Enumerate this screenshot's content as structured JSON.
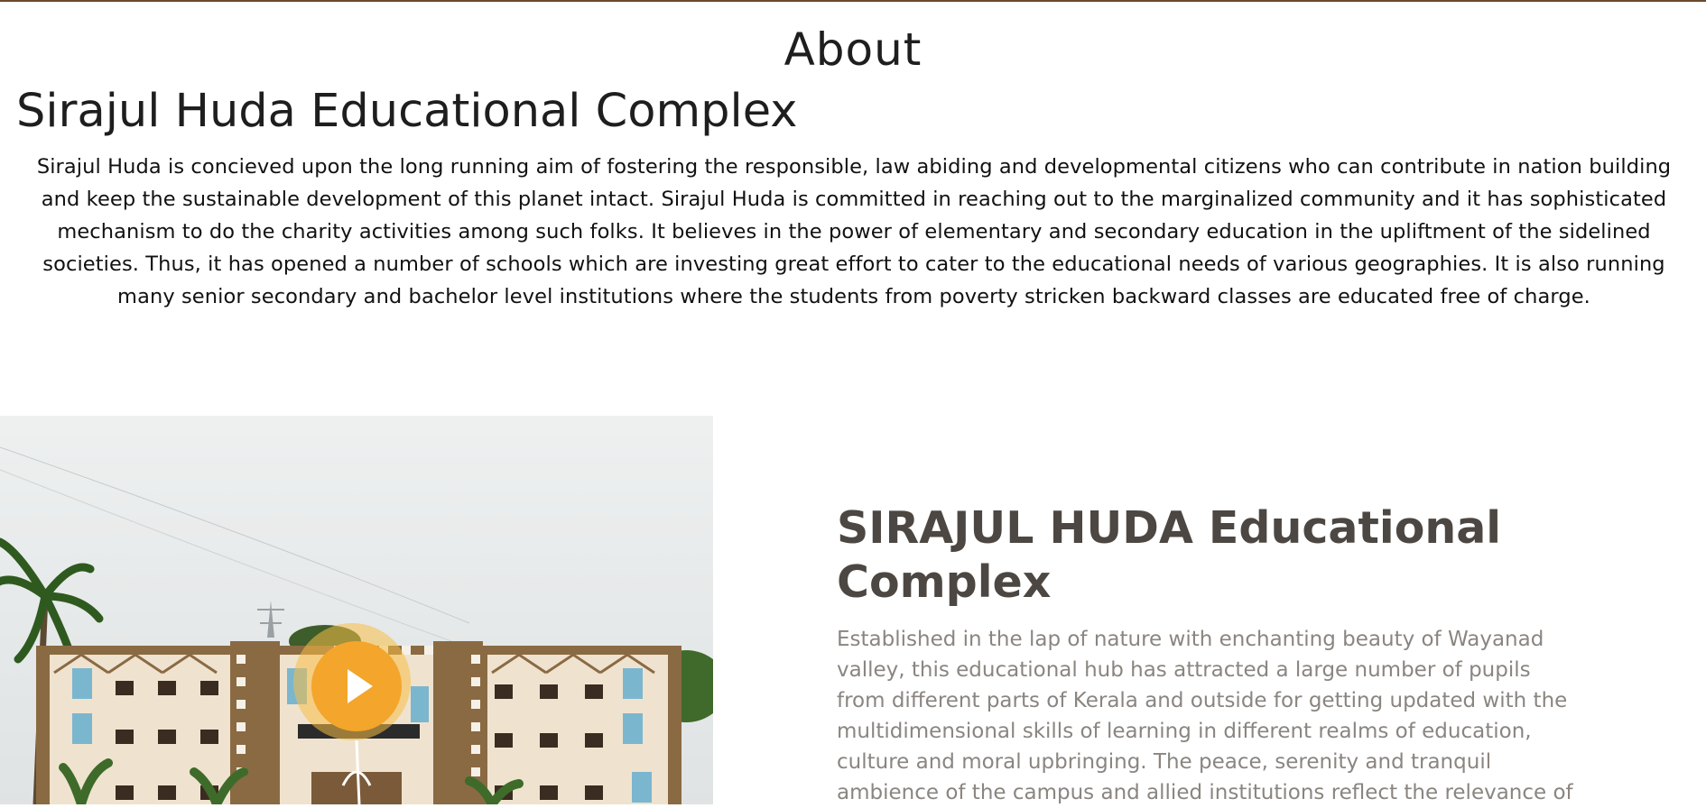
{
  "section": {
    "title": "About"
  },
  "organization": {
    "heading": "Sirajul Huda Educational Complex",
    "paragraph": "Sirajul Huda is concieved upon the long running aim of fostering the responsible, law abiding and developmental citizens who can contribute in nation building and keep the sustainable development of this planet intact. Sirajul Huda is committed in reaching out to the marginalized community and it has sophisticated mechanism to do the charity activities among such folks. It believes in the power of elementary and secondary education in the upliftment of the sidelined societies. Thus, it has opened a number of schools which are investing great effort to cater to the educational needs of various geographies. It is also running many senior secondary and bachelor level institutions where the students from poverty stricken backward classes are educated free of charge."
  },
  "feature": {
    "title": "SIRAJUL HUDA Educational Complex",
    "description": "Established in the lap of nature with enchanting beauty of Wayanad valley, this educational hub has attracted a large number of pupils from different parts of Kerala and outside for getting updated with the multidimensional skills of learning in different realms of education, culture and moral upbringing. The peace, serenity and tranquil ambience of the campus and allied institutions reflect the relevance of"
  },
  "media": {
    "play_icon": "play-icon",
    "accent_color": "#f4a52c"
  },
  "colors": {
    "top_rule": "#6b4a2e",
    "heading": "#1e1e1e",
    "feature_title": "#4c4742",
    "feature_text": "#8a8580"
  }
}
